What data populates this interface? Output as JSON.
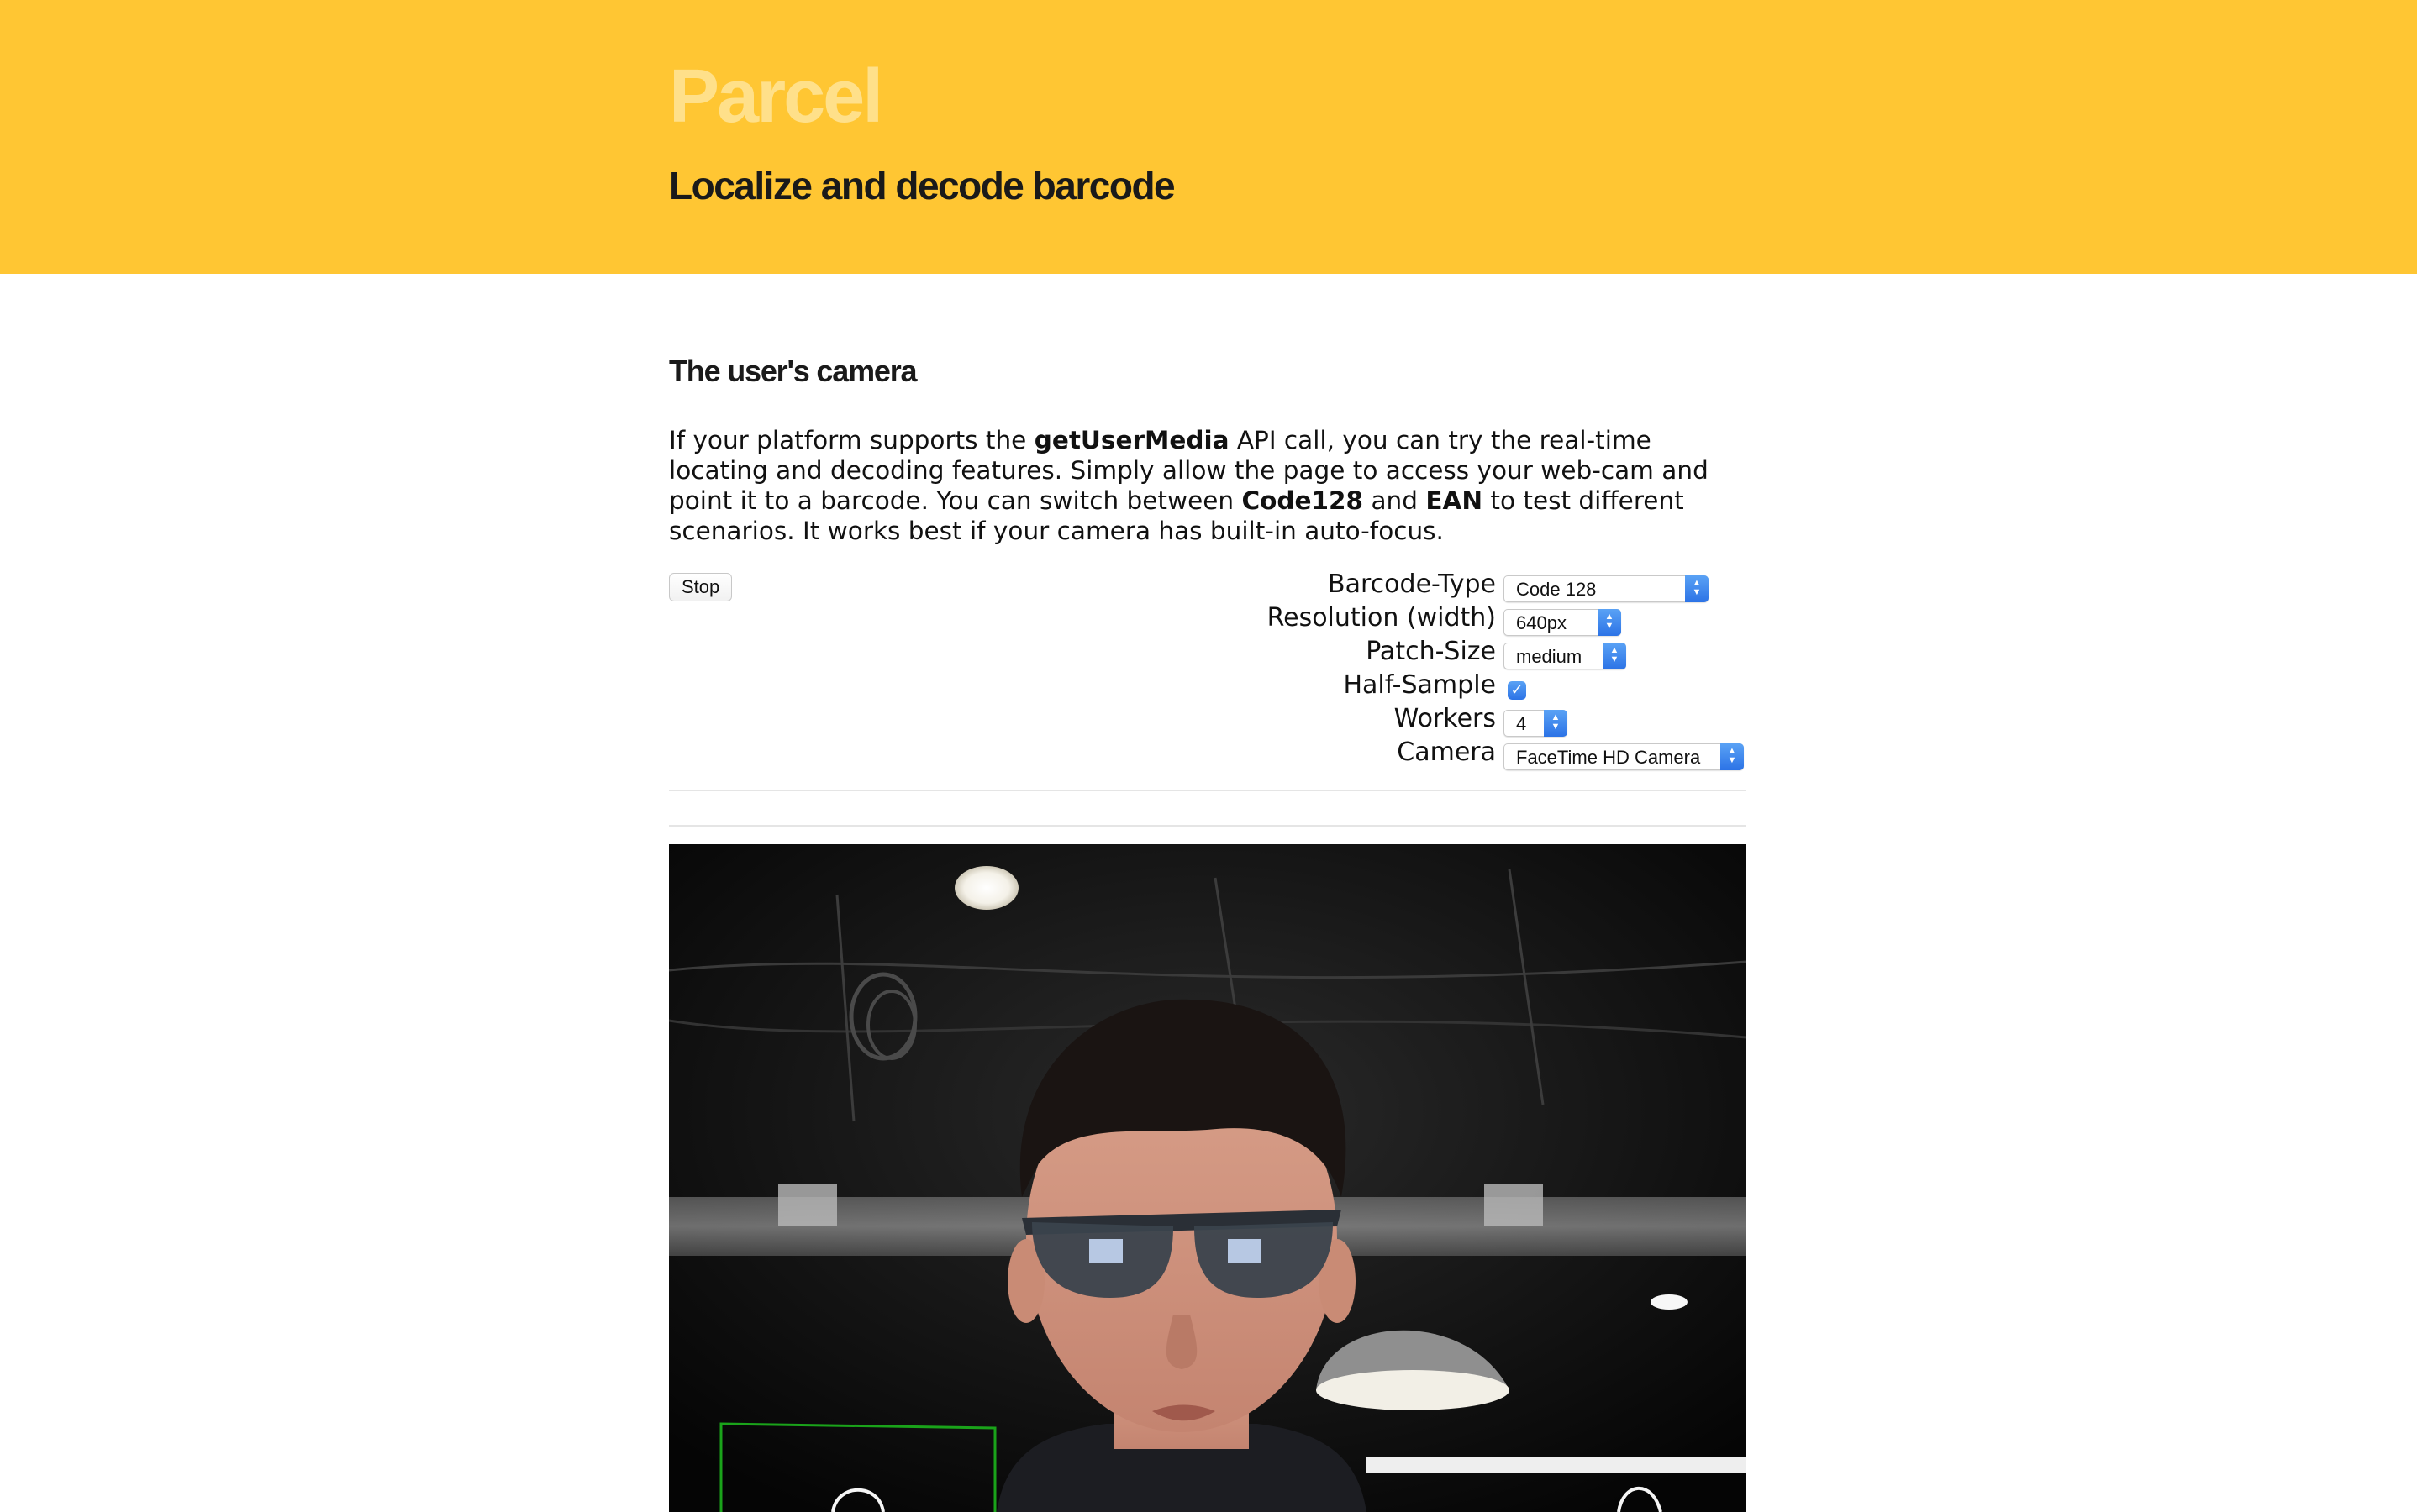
{
  "header": {
    "brand": "Parcel",
    "tagline": "Localize and decode barcode",
    "color": "#ffc633"
  },
  "section": {
    "title": "The user's camera",
    "intro": {
      "part1": "If your platform supports the ",
      "bold1": "getUserMedia",
      "part2": " API call, you can try the real-time locating and decoding features. Simply allow the page to access your web-cam and point it to a barcode. You can switch between ",
      "bold2": "Code128",
      "part3": " and ",
      "bold3": "EAN",
      "part4": " to test different scenarios. It works best if your camera has built-in auto-focus."
    }
  },
  "stop_button": {
    "label": "Stop"
  },
  "controls": {
    "barcode_type": {
      "label": "Barcode-Type",
      "value": "Code 128"
    },
    "resolution": {
      "label": "Resolution (width)",
      "value": "640px"
    },
    "patch_size": {
      "label": "Patch-Size",
      "value": "medium"
    },
    "half_sample": {
      "label": "Half-Sample",
      "checked": true
    },
    "workers": {
      "label": "Workers",
      "value": "4"
    },
    "camera": {
      "label": "Camera",
      "value": "FaceTime HD Camera"
    }
  },
  "viewport": {
    "description_icon": "camera-feed-icon"
  }
}
